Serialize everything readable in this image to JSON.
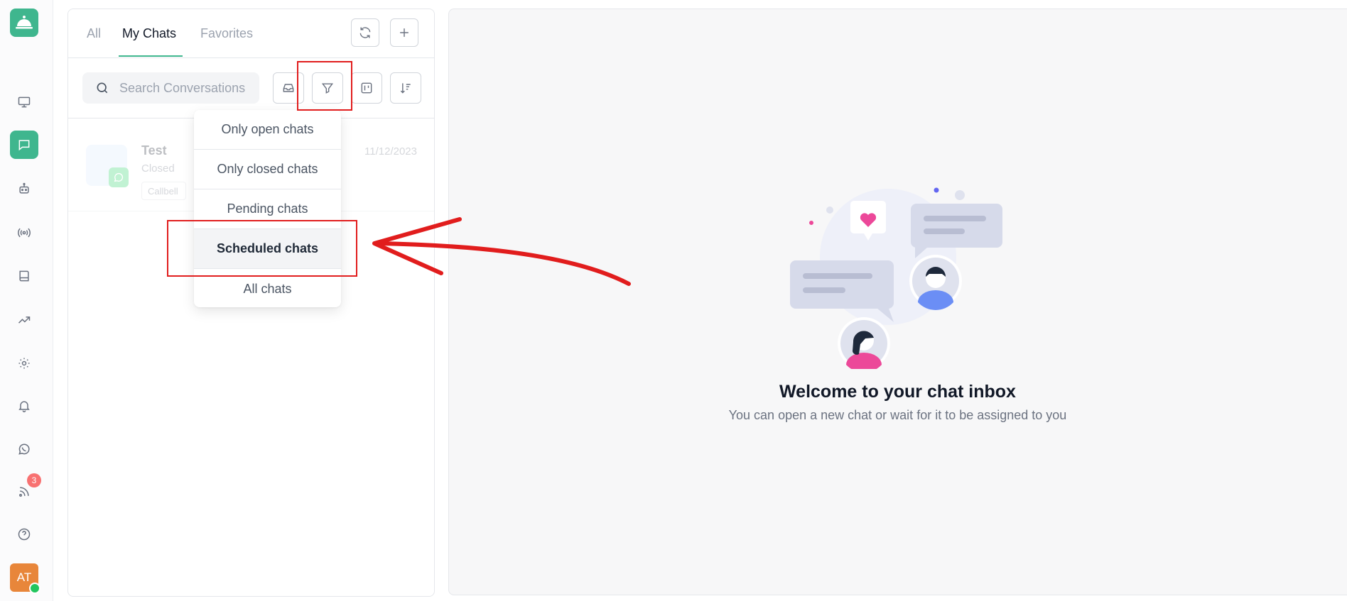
{
  "rail": {
    "items": [
      {
        "icon": "monitor-icon"
      },
      {
        "icon": "chat-icon",
        "active": true
      },
      {
        "icon": "bot-icon"
      },
      {
        "icon": "broadcast-icon"
      },
      {
        "icon": "book-icon"
      },
      {
        "icon": "trending-icon"
      },
      {
        "icon": "settings-icon"
      },
      {
        "icon": "bell-icon"
      },
      {
        "icon": "whatsapp-icon"
      },
      {
        "icon": "rss-icon",
        "badge": "3"
      },
      {
        "icon": "help-icon"
      }
    ],
    "avatar_initials": "AT"
  },
  "tabs": [
    {
      "label": "All"
    },
    {
      "label": "My Chats",
      "active": true
    },
    {
      "label": "Favorites"
    }
  ],
  "search": {
    "placeholder": "Search Conversations"
  },
  "chat_list": [
    {
      "name": "Test",
      "status": "Closed",
      "tag": "Callbell",
      "date": "11/12/2023",
      "channel": "whatsapp"
    }
  ],
  "filter_menu": {
    "items": [
      {
        "label": "Only open chats"
      },
      {
        "label": "Only closed chats"
      },
      {
        "label": "Pending chats"
      },
      {
        "label": "Scheduled chats",
        "highlighted": true
      },
      {
        "label": "All chats"
      }
    ]
  },
  "empty_state": {
    "title": "Welcome to your chat inbox",
    "subtitle": "You can open a new chat or wait for it to be assigned to you"
  },
  "colors": {
    "brand": "#3fb68e",
    "annotation": "#e11d1d",
    "badge": "#f87171",
    "avatar": "#e8863a"
  }
}
